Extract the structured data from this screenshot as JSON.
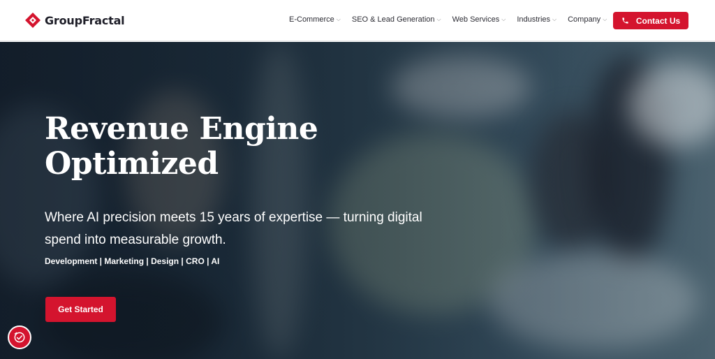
{
  "brand": {
    "name": "GroupFractal",
    "accent": "#d4142e"
  },
  "nav": {
    "items": [
      {
        "label": "E-Commerce"
      },
      {
        "label": "SEO & Lead Generation"
      },
      {
        "label": "Web Services"
      },
      {
        "label": "Industries"
      },
      {
        "label": "Company"
      }
    ],
    "contact_label": "Contact Us"
  },
  "hero": {
    "title_line1": "Revenue Engine",
    "title_line2": "Optimized",
    "subtitle": "Where AI precision meets 15 years of expertise — turning digital spend into measurable growth.",
    "tags": "Development | Marketing | Design | CRO | AI",
    "cta_label": "Get Started"
  },
  "icons": {
    "logo": "diamond-logo-icon",
    "phone": "phone-icon",
    "chevron": "chevron-down-icon",
    "accessibility": "accessibility-icon"
  }
}
